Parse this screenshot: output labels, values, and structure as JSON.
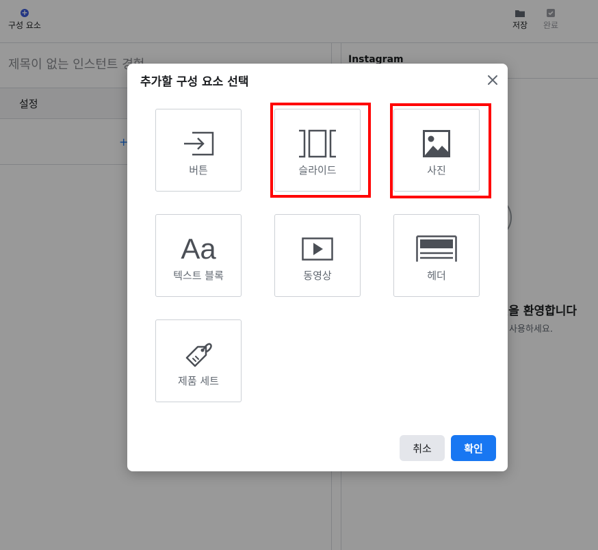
{
  "toolbar": {
    "add_label": "구성 요소",
    "save_label": "저장",
    "done_label": "완료"
  },
  "editor": {
    "doc_title": "제목이 없는 인스턴트 경험",
    "settings_label": "설정",
    "add_symbol": "+"
  },
  "preview": {
    "platform": "Instagram",
    "welcome_text": "! 것을 환영합니다",
    "use_button_hint": "튼을 사용하세요."
  },
  "modal": {
    "title": "추가할 구성 요소 선택",
    "components": [
      {
        "label": "버튼",
        "icon": "button-icon"
      },
      {
        "label": "슬라이드",
        "icon": "slideshow-icon"
      },
      {
        "label": "사진",
        "icon": "photo-icon"
      },
      {
        "label": "텍스트 블록",
        "icon": "text-block-icon",
        "glyph": "Aa"
      },
      {
        "label": "동영상",
        "icon": "video-icon"
      },
      {
        "label": "헤더",
        "icon": "header-icon"
      },
      {
        "label": "제품 세트",
        "icon": "product-set-icon"
      }
    ],
    "cancel_label": "취소",
    "confirm_label": "확인"
  },
  "colors": {
    "accent": "#1877f2",
    "highlight": "#ff0000",
    "icon": "#4b4f56"
  }
}
